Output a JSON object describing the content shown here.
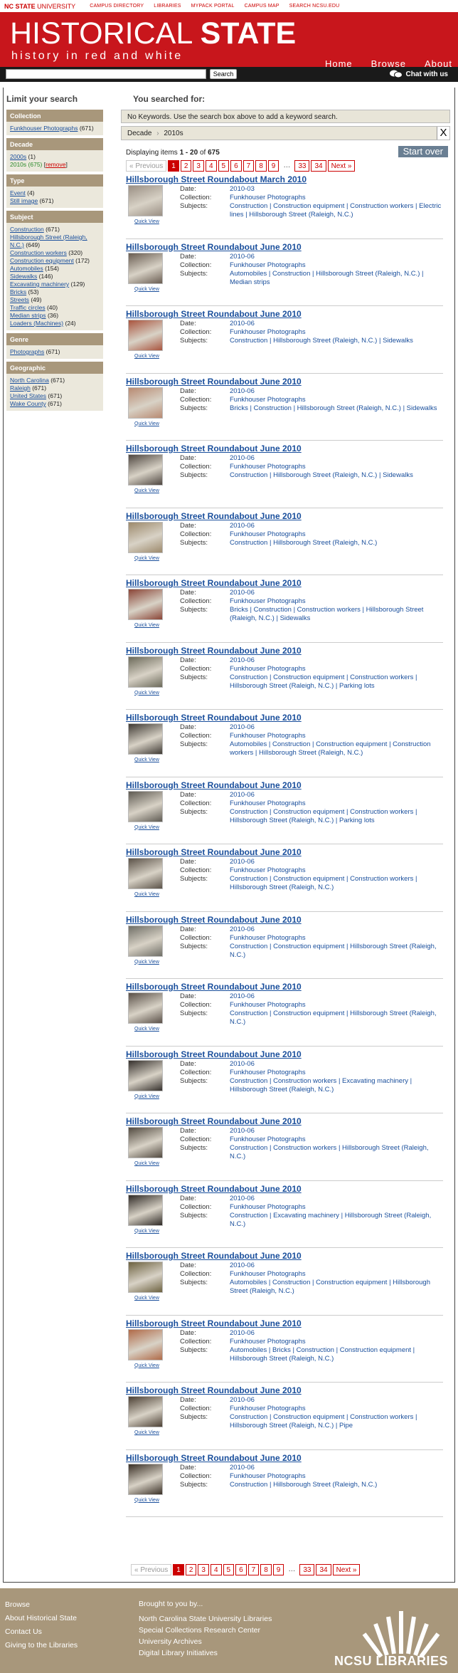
{
  "topbar": {
    "brand_bold": "NC STATE",
    "brand_rest": " UNIVERSITY",
    "links": [
      "CAMPUS DIRECTORY",
      "LIBRARIES",
      "MYPACK PORTAL",
      "CAMPUS MAP",
      "SEARCH NCSU.EDU"
    ]
  },
  "banner": {
    "title_a": "HISTORICAL ",
    "title_b": "STATE",
    "tagline": "history in red and white",
    "nav": [
      "Home",
      "Browse",
      "About"
    ]
  },
  "search": {
    "placeholder": "",
    "button": "Search",
    "chat": "Chat with us"
  },
  "sidebar": {
    "heading": "Limit your search",
    "facets": [
      {
        "title": "Collection",
        "items": [
          {
            "label": "Funkhouser Photographs",
            "count": "(671)"
          }
        ]
      },
      {
        "title": "Decade",
        "items": [
          {
            "label": "2000s",
            "count": "(1)"
          },
          {
            "label": "2010s",
            "count": "(675)",
            "selected": true,
            "remove": "remove"
          }
        ]
      },
      {
        "title": "Type",
        "items": [
          {
            "label": "Event",
            "count": "(4)"
          },
          {
            "label": "Still image",
            "count": "(671)"
          }
        ]
      },
      {
        "title": "Subject",
        "items": [
          {
            "label": "Construction",
            "count": "(671)"
          },
          {
            "label": "Hillsborough Street (Raleigh, N.C.)",
            "count": "(649)"
          },
          {
            "label": "Construction workers",
            "count": "(320)"
          },
          {
            "label": "Construction equipment",
            "count": "(172)"
          },
          {
            "label": "Automobiles",
            "count": "(154)"
          },
          {
            "label": "Sidewalks",
            "count": "(146)"
          },
          {
            "label": "Excavating machinery",
            "count": "(129)"
          },
          {
            "label": "Bricks",
            "count": "(53)"
          },
          {
            "label": "Streets",
            "count": "(49)"
          },
          {
            "label": "Traffic circles",
            "count": "(40)"
          },
          {
            "label": "Median strips",
            "count": "(36)"
          },
          {
            "label": "Loaders (Machines)",
            "count": "(24)"
          }
        ]
      },
      {
        "title": "Genre",
        "items": [
          {
            "label": "Photographs",
            "count": "(671)"
          }
        ]
      },
      {
        "title": "Geographic",
        "items": [
          {
            "label": "North Carolina",
            "count": "(671)"
          },
          {
            "label": "Raleigh",
            "count": "(671)"
          },
          {
            "label": "United States",
            "count": "(671)"
          },
          {
            "label": "Wake County",
            "count": "(671)"
          }
        ]
      }
    ]
  },
  "main": {
    "heading": "You searched for:",
    "no_keywords": "No Keywords. Use the search box above to add a keyword search.",
    "constraint_field": "Decade",
    "constraint_sep": "›",
    "constraint_value": "2010s",
    "constraint_remove": "X",
    "display_prefix": "Displaying items ",
    "display_range": "1 - 20",
    "display_of": " of ",
    "display_total": "675",
    "start_over": "Start over",
    "pager": {
      "prev": "« Previous",
      "pages": [
        "1",
        "2",
        "3",
        "4",
        "5",
        "6",
        "7",
        "8",
        "9"
      ],
      "gap": "…",
      "tail": [
        "33",
        "34"
      ],
      "next": "Next »"
    },
    "labels": {
      "date": "Date:",
      "collection": "Collection:",
      "subjects": "Subjects:",
      "quick_view": "Quick View"
    },
    "results": [
      {
        "title": "Hillsborough Street Roundabout March 2010",
        "date": "2010-03",
        "collection": "Funkhouser Photographs",
        "subjects": "Construction | Construction equipment | Construction workers | Electric lines | Hillsborough Street (Raleigh, N.C.)",
        "color": "#9a8f84"
      },
      {
        "title": "Hillsborough Street Roundabout June 2010",
        "date": "2010-06",
        "collection": "Funkhouser Photographs",
        "subjects": "Automobiles | Construction | Hillsborough Street (Raleigh, N.C.) | Median strips",
        "color": "#6a5d52"
      },
      {
        "title": "Hillsborough Street Roundabout June 2010",
        "date": "2010-06",
        "collection": "Funkhouser Photographs",
        "subjects": "Construction | Hillsborough Street (Raleigh, N.C.) | Sidewalks",
        "color": "#a9543e"
      },
      {
        "title": "Hillsborough Street Roundabout June 2010",
        "date": "2010-06",
        "collection": "Funkhouser Photographs",
        "subjects": "Bricks | Construction | Hillsborough Street (Raleigh, N.C.) | Sidewalks",
        "color": "#b88a72"
      },
      {
        "title": "Hillsborough Street Roundabout June 2010",
        "date": "2010-06",
        "collection": "Funkhouser Photographs",
        "subjects": "Construction | Hillsborough Street (Raleigh, N.C.) | Sidewalks",
        "color": "#4e4640"
      },
      {
        "title": "Hillsborough Street Roundabout June 2010",
        "date": "2010-06",
        "collection": "Funkhouser Photographs",
        "subjects": "Construction | Hillsborough Street (Raleigh, N.C.)",
        "color": "#9d8a6c"
      },
      {
        "title": "Hillsborough Street Roundabout June 2010",
        "date": "2010-06",
        "collection": "Funkhouser Photographs",
        "subjects": "Bricks | Construction | Construction workers | Hillsborough Street (Raleigh, N.C.) | Sidewalks",
        "color": "#8a4436"
      },
      {
        "title": "Hillsborough Street Roundabout June 2010",
        "date": "2010-06",
        "collection": "Funkhouser Photographs",
        "subjects": "Construction | Construction equipment | Construction workers | Hillsborough Street (Raleigh, N.C.) | Parking lots",
        "color": "#6c6a5a"
      },
      {
        "title": "Hillsborough Street Roundabout June 2010",
        "date": "2010-06",
        "collection": "Funkhouser Photographs",
        "subjects": "Automobiles | Construction | Construction equipment | Construction workers | Hillsborough Street (Raleigh, N.C.)",
        "color": "#3f3a34"
      },
      {
        "title": "Hillsborough Street Roundabout June 2010",
        "date": "2010-06",
        "collection": "Funkhouser Photographs",
        "subjects": "Construction | Construction equipment | Construction workers | Hillsborough Street (Raleigh, N.C.) | Parking lots",
        "color": "#5e5a52"
      },
      {
        "title": "Hillsborough Street Roundabout June 2010",
        "date": "2010-06",
        "collection": "Funkhouser Photographs",
        "subjects": "Construction | Construction equipment | Construction workers | Hillsborough Street (Raleigh, N.C.)",
        "color": "#5b5248"
      },
      {
        "title": "Hillsborough Street Roundabout June 2010",
        "date": "2010-06",
        "collection": "Funkhouser Photographs",
        "subjects": "Construction | Construction equipment | Hillsborough Street (Raleigh, N.C.)",
        "color": "#6f6e66"
      },
      {
        "title": "Hillsborough Street Roundabout June 2010",
        "date": "2010-06",
        "collection": "Funkhouser Photographs",
        "subjects": "Construction | Construction equipment | Hillsborough Street (Raleigh, N.C.)",
        "color": "#5a5048"
      },
      {
        "title": "Hillsborough Street Roundabout June 2010",
        "date": "2010-06",
        "collection": "Funkhouser Photographs",
        "subjects": "Construction | Construction workers | Excavating machinery | Hillsborough Street (Raleigh, N.C.)",
        "color": "#35302c"
      },
      {
        "title": "Hillsborough Street Roundabout June 2010",
        "date": "2010-06",
        "collection": "Funkhouser Photographs",
        "subjects": "Construction | Construction workers | Hillsborough Street (Raleigh, N.C.)",
        "color": "#524a40"
      },
      {
        "title": "Hillsborough Street Roundabout June 2010",
        "date": "2010-06",
        "collection": "Funkhouser Photographs",
        "subjects": "Construction | Excavating machinery | Hillsborough Street (Raleigh, N.C.)",
        "color": "#2f2a26"
      },
      {
        "title": "Hillsborough Street Roundabout June 2010",
        "date": "2010-06",
        "collection": "Funkhouser Photographs",
        "subjects": "Automobiles | Construction | Construction equipment | Hillsborough Street (Raleigh, N.C.)",
        "color": "#6d6240"
      },
      {
        "title": "Hillsborough Street Roundabout June 2010",
        "date": "2010-06",
        "collection": "Funkhouser Photographs",
        "subjects": "Automobiles | Bricks | Construction | Construction equipment | Hillsborough Street (Raleigh, N.C.)",
        "color": "#b06a48"
      },
      {
        "title": "Hillsborough Street Roundabout June 2010",
        "date": "2010-06",
        "collection": "Funkhouser Photographs",
        "subjects": "Construction | Construction equipment | Construction workers | Hillsborough Street (Raleigh, N.C.) | Pipe",
        "color": "#4c4034"
      },
      {
        "title": "Hillsborough Street Roundabout June 2010",
        "date": "2010-06",
        "collection": "Funkhouser Photographs",
        "subjects": "Construction | Hillsborough Street (Raleigh, N.C.)",
        "color": "#3a3026"
      }
    ]
  },
  "footer": {
    "links": [
      "Browse",
      "About Historical State",
      "Contact Us",
      "Giving to the Libraries"
    ],
    "brought": "Brought to you by...",
    "orgs": [
      "North Carolina State University Libraries",
      "Special Collections Research Center",
      "University Archives",
      "Digital Library Initiatives"
    ],
    "logo_text": "NCSU LIBRARIES"
  }
}
